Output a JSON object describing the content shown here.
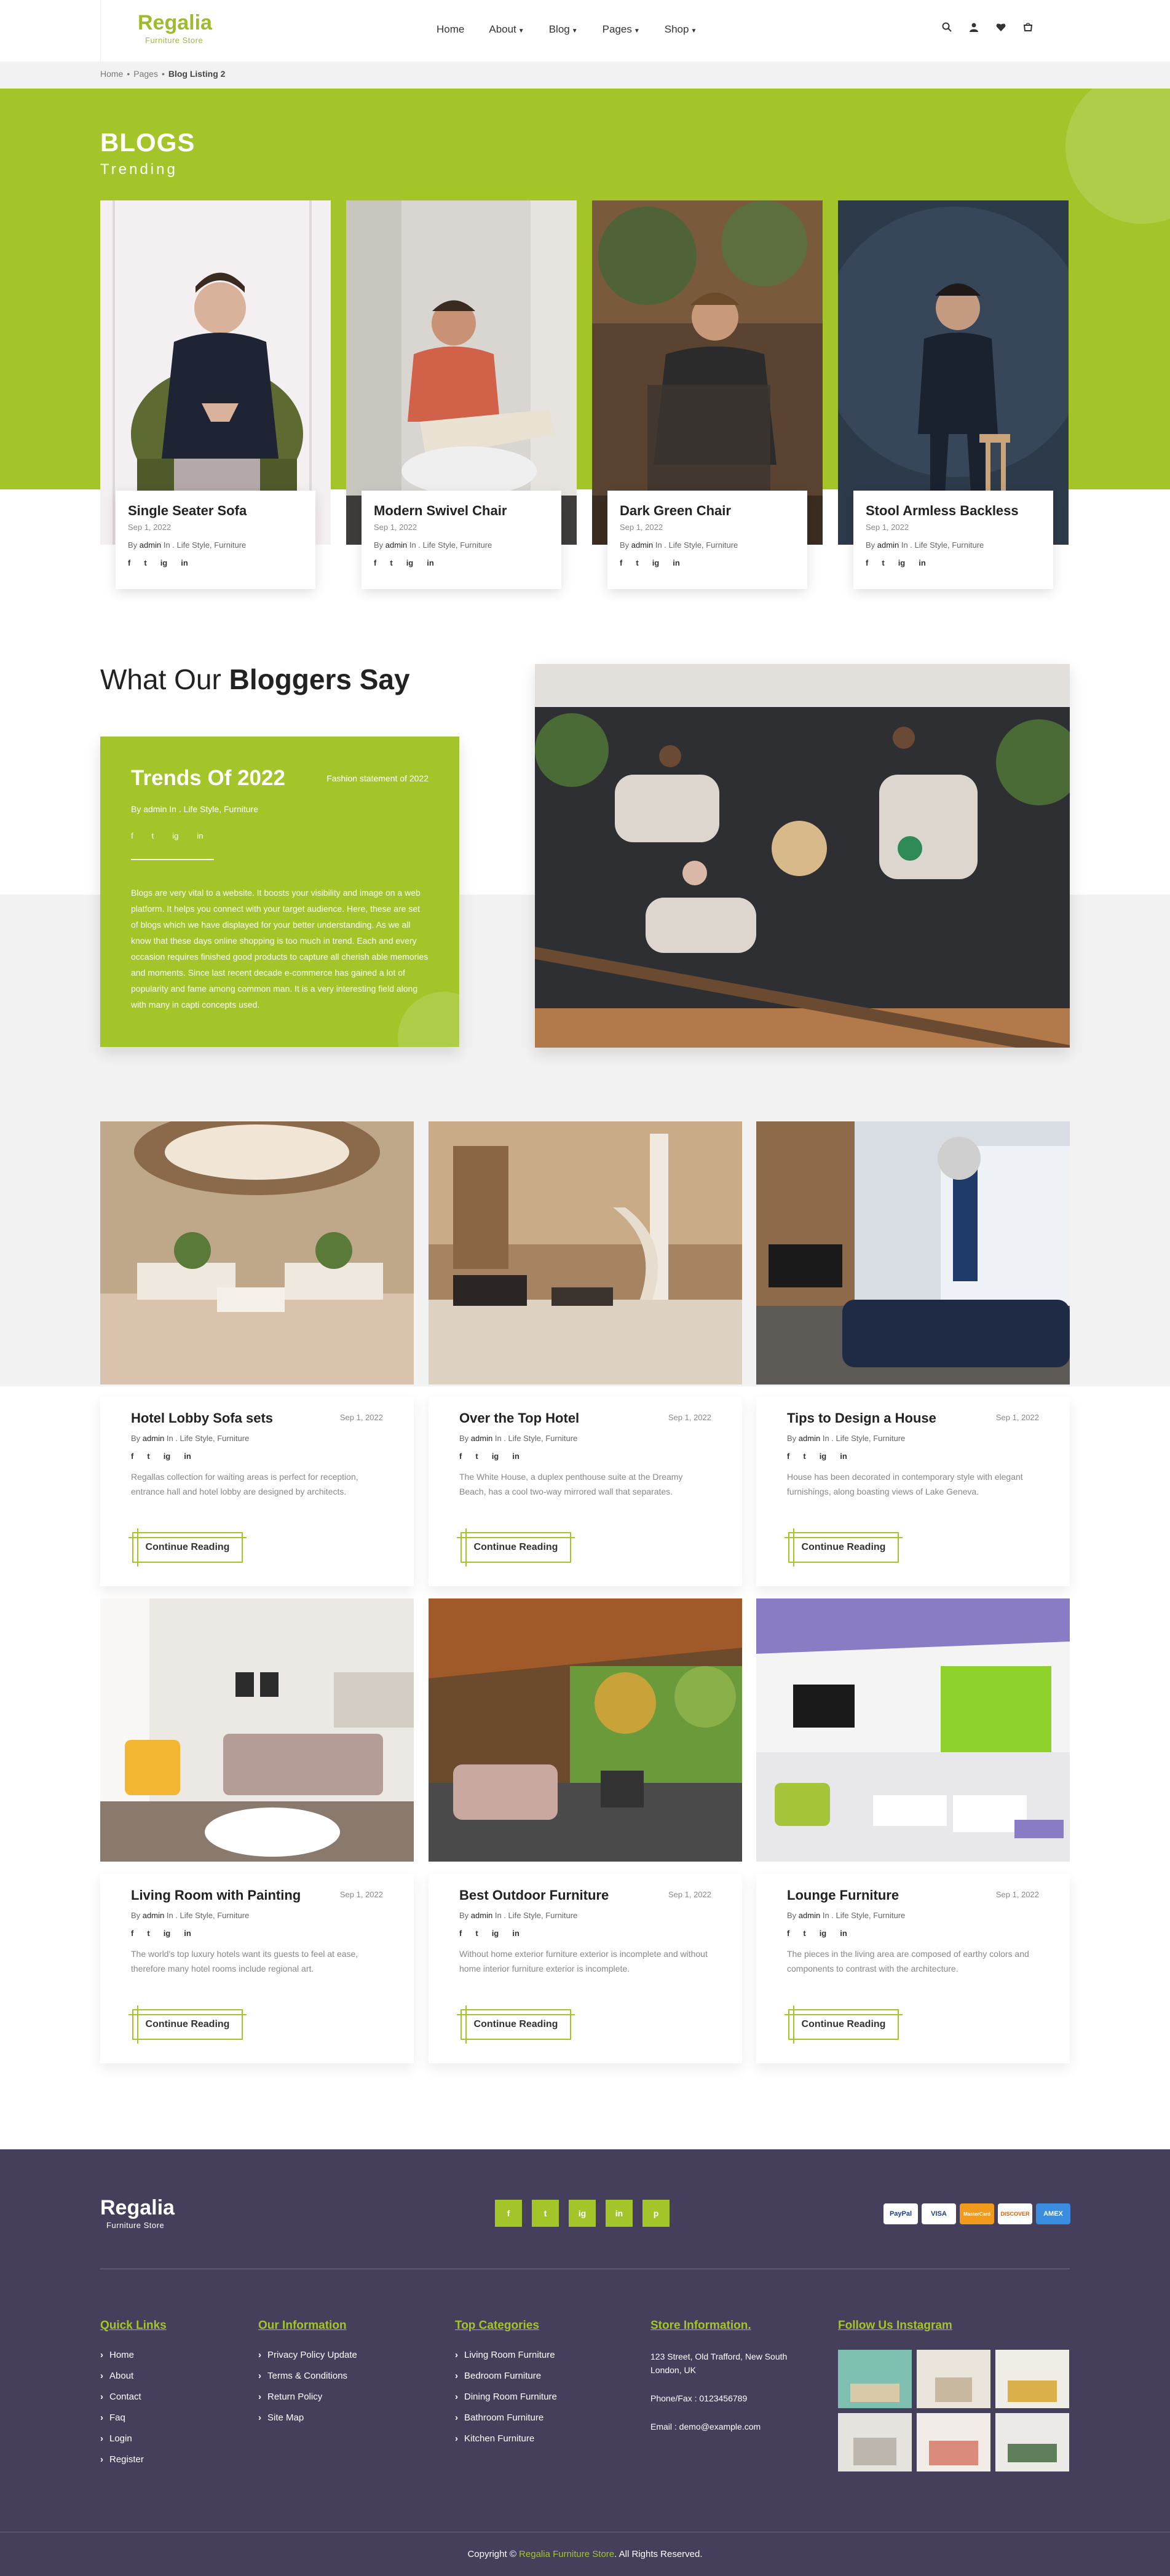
{
  "header": {
    "logo": "Regalia",
    "logo_sub": "Furniture Store",
    "nav": [
      "Home",
      "About",
      "Blog",
      "Pages",
      "Shop"
    ],
    "icons": [
      "search-icon",
      "user-icon",
      "heart-icon",
      "cart-icon"
    ]
  },
  "breadcrumb": [
    "Home",
    "Pages",
    "Blog Listing 2"
  ],
  "hero": {
    "title": "BLOGS",
    "subtitle": "Trending",
    "accent_color": "#a3c52a"
  },
  "trending": [
    {
      "title": "Single Seater Sofa",
      "date": "Sep 1, 2022",
      "by": "By",
      "author": "admin",
      "in": "In",
      "cats": "Life Style, Furniture"
    },
    {
      "title": "Modern Swivel Chair",
      "date": "Sep 1, 2022",
      "by": "By",
      "author": "admin",
      "in": "In",
      "cats": "Life Style, Furniture"
    },
    {
      "title": "Dark Green Chair",
      "date": "Sep 1, 2022",
      "by": "By",
      "author": "admin",
      "in": "In",
      "cats": "Life Style, Furniture"
    },
    {
      "title": "Stool Armless Backless",
      "date": "Sep 1, 2022",
      "by": "By",
      "author": "admin",
      "in": "In",
      "cats": "Life Style, Furniture"
    }
  ],
  "social_labels": [
    "f",
    "t",
    "ig",
    "in"
  ],
  "bloggers": {
    "title_light": "What Our",
    "title_bold": "Bloggers Say",
    "card_title": "Trends Of 2022",
    "card_tag": "Fashion statement of 2022",
    "card_meta": "By admin In . Life Style, Furniture",
    "card_text": "Blogs are very vital to a website. It boosts your visibility and image on a web platform. It helps you connect with your target audience. Here, these are set of blogs which we have displayed for your better understanding. As we all know that these days online shopping is too much in trend. Each and every occasion requires finished good products to capture all cherish able memories and moments. Since last recent decade e-commerce has gained a lot of popularity and fame among common man. It is a very interesting field along with many in capti concepts used."
  },
  "blogs": [
    {
      "title": "Hotel Lobby Sofa sets",
      "date": "Sep 1, 2022",
      "by": "By",
      "author": "admin",
      "in": "In . ",
      "cats": "Life Style, Furniture",
      "text": "Regallas collection for waiting areas is perfect for reception, entrance hall and hotel lobby are designed by architects.",
      "button": "Continue Reading"
    },
    {
      "title": "Over the Top Hotel",
      "date": "Sep 1, 2022",
      "by": "By",
      "author": "admin",
      "in": "In . ",
      "cats": "Life Style, Furniture",
      "text": "The White House, a duplex penthouse suite at the Dreamy Beach, has a cool two-way mirrored wall that separates.",
      "button": "Continue Reading"
    },
    {
      "title": "Tips to Design a House",
      "date": "Sep 1, 2022",
      "by": "By",
      "author": "admin",
      "in": "In . ",
      "cats": "Life Style, Furniture",
      "text": "House has been decorated in contemporary style with elegant furnishings, along boasting views of Lake Geneva.",
      "button": "Continue Reading"
    },
    {
      "title": "Living Room with Painting",
      "date": "Sep 1, 2022",
      "by": "By",
      "author": "admin",
      "in": "In . ",
      "cats": "Life Style, Furniture",
      "text": "The world's top luxury hotels want its guests to feel at ease, therefore many hotel rooms include regional art.",
      "button": "Continue Reading"
    },
    {
      "title": "Best Outdoor Furniture",
      "date": "Sep 1, 2022",
      "by": "By",
      "author": "admin",
      "in": "In . ",
      "cats": "Life Style, Furniture",
      "text": "Without home exterior furniture exterior is incomplete and without home interior furniture exterior is incomplete.",
      "button": "Continue Reading"
    },
    {
      "title": "Lounge Furniture",
      "date": "Sep 1, 2022",
      "by": "By",
      "author": "admin",
      "in": "In . ",
      "cats": "Life Style, Furniture",
      "text": "The pieces in the living area are composed of earthy colors and components to contrast with the architecture.",
      "button": "Continue Reading"
    }
  ],
  "footer": {
    "logo": "Regalia",
    "logo_sub": "Furniture Store",
    "social": [
      "f",
      "t",
      "ig",
      "in",
      "p"
    ],
    "payments": [
      "PayPal",
      "VISA",
      "MasterCard",
      "DISCOVER",
      "AMEX"
    ],
    "quick_links": {
      "title": "Quick Links",
      "items": [
        "Home",
        "About",
        "Contact",
        "Faq",
        "Login",
        "Register"
      ]
    },
    "our_info": {
      "title": "Our Information",
      "items": [
        "Privacy Policy Update",
        "Terms & Conditions",
        "Return Policy",
        "Site Map"
      ]
    },
    "top_categories": {
      "title": "Top Categories",
      "items": [
        "Living Room Furniture",
        "Bedroom Furniture",
        "Dining Room Furniture",
        "Bathroom Furniture",
        "Kitchen Furniture"
      ]
    },
    "store": {
      "title": "Store Information.",
      "address": "123 Street, Old Trafford, New South London, UK",
      "phone": "Phone/Fax : 0123456789",
      "email": "Email : demo@example.com"
    },
    "instagram": {
      "title": "Follow Us Instagram"
    },
    "copyright_pre": "Copyright ©",
    "copyright_brand": "Regalia Furniture Store",
    "copyright_post": ". All Rights Reserved."
  }
}
